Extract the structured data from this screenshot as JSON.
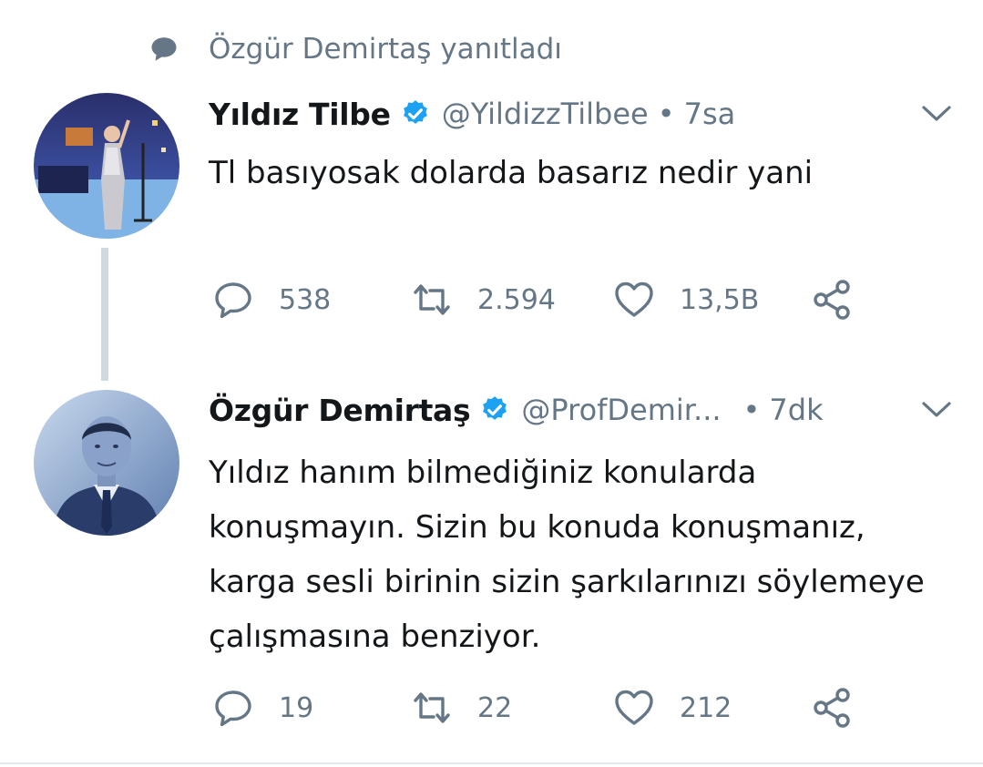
{
  "reply_context": {
    "text": "Özgür Demirtaş yanıtladı",
    "icon": "speech-bubble-icon"
  },
  "colors": {
    "muted": "#657786",
    "verified": "#1da1f2",
    "thread_line": "#cfd9de"
  },
  "tweets": [
    {
      "name": "Yıldız Tilbe",
      "verified": true,
      "handle": "@YildizzTilbee",
      "separator": "•",
      "time": "7sa",
      "text": "Tl basıyosak dolarda basarız nedir yani",
      "replies": "538",
      "retweets": "2.594",
      "likes": "13,5B"
    },
    {
      "name": "Özgür Demirtaş",
      "verified": true,
      "handle": "@ProfDemir...",
      "separator": "•",
      "time": "7dk",
      "text": "Yıldız hanım bilmediğiniz konularda konuşmayın. Sizin bu konuda konuşmanız, karga sesli birinin sizin şarkılarınızı söylemeye çalışmasına benziyor.",
      "replies": "19",
      "retweets": "22",
      "likes": "212"
    }
  ]
}
